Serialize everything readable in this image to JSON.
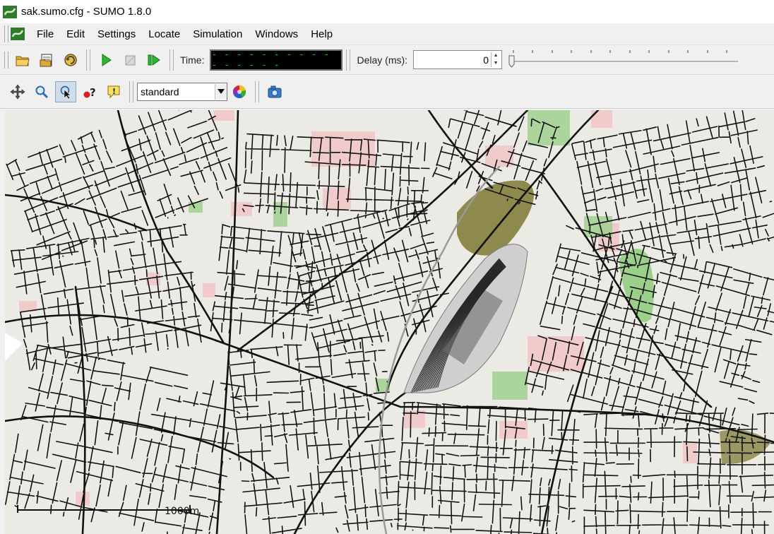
{
  "window": {
    "title": "sak.sumo.cfg - SUMO 1.8.0"
  },
  "menu": {
    "items": [
      "File",
      "Edit",
      "Settings",
      "Locate",
      "Simulation",
      "Windows",
      "Help"
    ]
  },
  "toolbar": {
    "open_icon": "open-folder-icon",
    "reload_icon": "reload-icon",
    "run_label": "run",
    "time_label": "Time:",
    "time_value": "- - - - - - - - - - - - - - - -",
    "delay_label": "Delay (ms):",
    "delay_value": "0"
  },
  "view_toolbar": {
    "scheme": "standard"
  },
  "map": {
    "scale_label": "1000m",
    "colors": {
      "background": "#ebeae4",
      "road": "#111111",
      "park": "#9bd08a",
      "industrial": "#8e8a4e",
      "residential": "#f2c8c8"
    }
  }
}
